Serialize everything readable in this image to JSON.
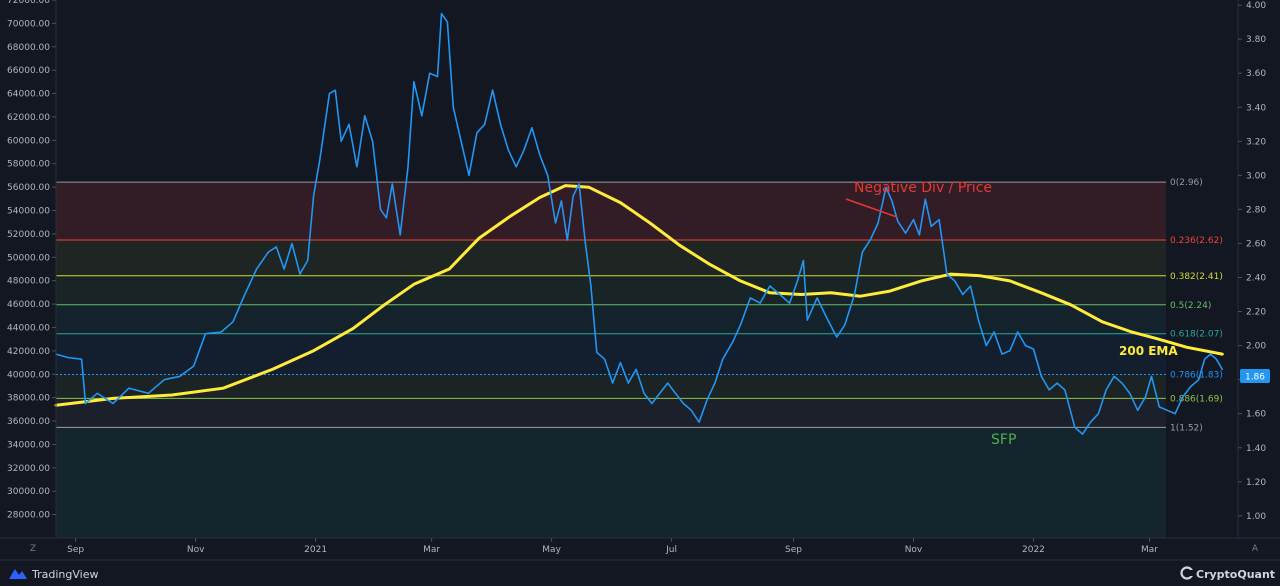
{
  "footer": {
    "left_brand": "TradingView",
    "right_brand": "CryptoQuant",
    "left_corner": "Z",
    "right_corner": "A",
    "left_logo_icon": "tradingview-logo-icon",
    "right_logo_icon": "cryptoquant-logo-icon"
  },
  "price_badge": "1.86",
  "colors": {
    "background": "#131722",
    "price_line": "#2196f3",
    "ema_line": "#ffeb3b",
    "negative_div": "#e53935",
    "sfp": "#4caf50",
    "badge": "#2196f3"
  },
  "annotations": {
    "negative_div": "Negative Div / Price",
    "sfp": "SFP",
    "ema": "200 EMA"
  },
  "chart_data": {
    "type": "line",
    "title": "",
    "x_axis": {
      "type": "time",
      "tick_labels": [
        "Sep",
        "Nov",
        "2021",
        "Mar",
        "May",
        "Jul",
        "Sep",
        "Nov",
        "2022",
        "Mar"
      ],
      "tick_dates": [
        "2020-09-01",
        "2020-11-01",
        "2021-01-01",
        "2021-03-01",
        "2021-05-01",
        "2021-07-01",
        "2021-09-01",
        "2021-11-01",
        "2022-01-01",
        "2022-03-01"
      ],
      "range": [
        "2020-08-22",
        "2022-04-15"
      ]
    },
    "y_axis_left": {
      "ticks": [
        "72000.00",
        "70000.00",
        "68000.00",
        "66000.00",
        "64000.00",
        "62000.00",
        "60000.00",
        "58000.00",
        "56000.00",
        "54000.00",
        "52000.00",
        "50000.00",
        "48000.00",
        "46000.00",
        "44000.00",
        "42000.00",
        "40000.00",
        "38000.00",
        "36000.00",
        "34000.00",
        "32000.00",
        "30000.00",
        "28000.00"
      ],
      "range": [
        26000,
        72000
      ]
    },
    "y_axis_right": {
      "ticks": [
        "4.00",
        "3.80",
        "3.60",
        "3.40",
        "3.20",
        "3.00",
        "2.80",
        "2.60",
        "2.40",
        "2.20",
        "2.00",
        "1.80",
        "1.60",
        "1.40",
        "1.20",
        "1.00"
      ],
      "range": [
        0.87,
        4.03
      ]
    },
    "fib_levels": [
      {
        "label": "0(2.96)",
        "value": 2.96,
        "color": "#9598a1"
      },
      {
        "label": "0.236(2.62)",
        "value": 2.62,
        "color": "#f44336"
      },
      {
        "label": "0.382(2.41)",
        "value": 2.41,
        "color": "#cddc39"
      },
      {
        "label": "0.5(2.24)",
        "value": 2.24,
        "color": "#66bb6a"
      },
      {
        "label": "0.618(2.07)",
        "value": 2.07,
        "color": "#26a69a"
      },
      {
        "label": "0.786(1.83)",
        "value": 1.83,
        "color": "#2196f3"
      },
      {
        "label": "0.886(1.69)",
        "value": 1.69,
        "color": "#8bc34a"
      },
      {
        "label": "1(1.52)",
        "value": 1.52,
        "color": "#9e9e9e"
      }
    ],
    "series": [
      {
        "name": "",
        "axis": "right",
        "color": "#2196f3",
        "points": [
          [
            "2020-08-22",
            1.95
          ],
          [
            "2020-08-28",
            1.93
          ],
          [
            "2020-09-04",
            1.92
          ],
          [
            "2020-09-06",
            1.66
          ],
          [
            "2020-09-12",
            1.72
          ],
          [
            "2020-09-20",
            1.66
          ],
          [
            "2020-09-28",
            1.75
          ],
          [
            "2020-10-08",
            1.72
          ],
          [
            "2020-10-16",
            1.8
          ],
          [
            "2020-10-24",
            1.82
          ],
          [
            "2020-10-31",
            1.88
          ],
          [
            "2020-11-06",
            2.07
          ],
          [
            "2020-11-14",
            2.08
          ],
          [
            "2020-11-20",
            2.14
          ],
          [
            "2020-11-26",
            2.3
          ],
          [
            "2020-12-02",
            2.45
          ],
          [
            "2020-12-08",
            2.55
          ],
          [
            "2020-12-12",
            2.58
          ],
          [
            "2020-12-16",
            2.45
          ],
          [
            "2020-12-20",
            2.6
          ],
          [
            "2020-12-24",
            2.42
          ],
          [
            "2020-12-28",
            2.5
          ],
          [
            "2020-12-31",
            2.88
          ],
          [
            "2021-01-03",
            3.08
          ],
          [
            "2021-01-08",
            3.48
          ],
          [
            "2021-01-11",
            3.5
          ],
          [
            "2021-01-14",
            3.2
          ],
          [
            "2021-01-18",
            3.3
          ],
          [
            "2021-01-22",
            3.05
          ],
          [
            "2021-01-26",
            3.35
          ],
          [
            "2021-01-30",
            3.2
          ],
          [
            "2021-02-03",
            2.8
          ],
          [
            "2021-02-06",
            2.75
          ],
          [
            "2021-02-09",
            2.95
          ],
          [
            "2021-02-13",
            2.65
          ],
          [
            "2021-02-17",
            3.05
          ],
          [
            "2021-02-20",
            3.55
          ],
          [
            "2021-02-24",
            3.35
          ],
          [
            "2021-02-28",
            3.6
          ],
          [
            "2021-03-04",
            3.58
          ],
          [
            "2021-03-06",
            3.95
          ],
          [
            "2021-03-09",
            3.9
          ],
          [
            "2021-03-12",
            3.4
          ],
          [
            "2021-03-16",
            3.2
          ],
          [
            "2021-03-20",
            3.0
          ],
          [
            "2021-03-24",
            3.25
          ],
          [
            "2021-03-28",
            3.3
          ],
          [
            "2021-04-01",
            3.5
          ],
          [
            "2021-04-05",
            3.3
          ],
          [
            "2021-04-09",
            3.15
          ],
          [
            "2021-04-13",
            3.05
          ],
          [
            "2021-04-17",
            3.15
          ],
          [
            "2021-04-21",
            3.28
          ],
          [
            "2021-04-25",
            3.12
          ],
          [
            "2021-04-29",
            3.0
          ],
          [
            "2021-05-03",
            2.72
          ],
          [
            "2021-05-06",
            2.85
          ],
          [
            "2021-05-09",
            2.62
          ],
          [
            "2021-05-12",
            2.88
          ],
          [
            "2021-05-15",
            2.95
          ],
          [
            "2021-05-18",
            2.62
          ],
          [
            "2021-05-21",
            2.35
          ],
          [
            "2021-05-24",
            1.96
          ],
          [
            "2021-05-28",
            1.92
          ],
          [
            "2021-06-01",
            1.78
          ],
          [
            "2021-06-05",
            1.9
          ],
          [
            "2021-06-09",
            1.78
          ],
          [
            "2021-06-13",
            1.86
          ],
          [
            "2021-06-17",
            1.72
          ],
          [
            "2021-06-21",
            1.66
          ],
          [
            "2021-06-25",
            1.72
          ],
          [
            "2021-06-29",
            1.78
          ],
          [
            "2021-07-03",
            1.72
          ],
          [
            "2021-07-07",
            1.66
          ],
          [
            "2021-07-11",
            1.62
          ],
          [
            "2021-07-15",
            1.55
          ],
          [
            "2021-07-19",
            1.68
          ],
          [
            "2021-07-23",
            1.78
          ],
          [
            "2021-07-27",
            1.92
          ],
          [
            "2021-08-01",
            2.02
          ],
          [
            "2021-08-05",
            2.12
          ],
          [
            "2021-08-10",
            2.28
          ],
          [
            "2021-08-15",
            2.25
          ],
          [
            "2021-08-20",
            2.35
          ],
          [
            "2021-08-25",
            2.3
          ],
          [
            "2021-08-30",
            2.25
          ],
          [
            "2021-09-03",
            2.38
          ],
          [
            "2021-09-06",
            2.5
          ],
          [
            "2021-09-08",
            2.15
          ],
          [
            "2021-09-13",
            2.28
          ],
          [
            "2021-09-18",
            2.16
          ],
          [
            "2021-09-23",
            2.05
          ],
          [
            "2021-09-27",
            2.12
          ],
          [
            "2021-10-02",
            2.3
          ],
          [
            "2021-10-06",
            2.55
          ],
          [
            "2021-10-10",
            2.62
          ],
          [
            "2021-10-14",
            2.72
          ],
          [
            "2021-10-18",
            2.93
          ],
          [
            "2021-10-21",
            2.85
          ],
          [
            "2021-10-24",
            2.73
          ],
          [
            "2021-10-28",
            2.66
          ],
          [
            "2021-11-01",
            2.74
          ],
          [
            "2021-11-04",
            2.65
          ],
          [
            "2021-11-07",
            2.86
          ],
          [
            "2021-11-10",
            2.7
          ],
          [
            "2021-11-14",
            2.74
          ],
          [
            "2021-11-18",
            2.42
          ],
          [
            "2021-11-22",
            2.38
          ],
          [
            "2021-11-26",
            2.3
          ],
          [
            "2021-11-30",
            2.35
          ],
          [
            "2021-12-04",
            2.15
          ],
          [
            "2021-12-08",
            2.0
          ],
          [
            "2021-12-12",
            2.08
          ],
          [
            "2021-12-16",
            1.95
          ],
          [
            "2021-12-20",
            1.97
          ],
          [
            "2021-12-24",
            2.08
          ],
          [
            "2021-12-28",
            2.0
          ],
          [
            "2022-01-01",
            1.98
          ],
          [
            "2022-01-05",
            1.82
          ],
          [
            "2022-01-09",
            1.74
          ],
          [
            "2022-01-13",
            1.78
          ],
          [
            "2022-01-17",
            1.74
          ],
          [
            "2022-01-22",
            1.52
          ],
          [
            "2022-01-26",
            1.48
          ],
          [
            "2022-01-30",
            1.55
          ],
          [
            "2022-02-03",
            1.6
          ],
          [
            "2022-02-07",
            1.74
          ],
          [
            "2022-02-11",
            1.82
          ],
          [
            "2022-02-15",
            1.78
          ],
          [
            "2022-02-19",
            1.72
          ],
          [
            "2022-02-23",
            1.62
          ],
          [
            "2022-02-27",
            1.7
          ],
          [
            "2022-03-02",
            1.82
          ],
          [
            "2022-03-06",
            1.64
          ],
          [
            "2022-03-10",
            1.62
          ],
          [
            "2022-03-14",
            1.6
          ],
          [
            "2022-03-18",
            1.7
          ],
          [
            "2022-03-22",
            1.76
          ],
          [
            "2022-03-26",
            1.8
          ],
          [
            "2022-03-29",
            1.92
          ],
          [
            "2022-04-01",
            1.95
          ],
          [
            "2022-04-04",
            1.92
          ],
          [
            "2022-04-07",
            1.86
          ]
        ]
      },
      {
        "name": "200 EMA",
        "axis": "right",
        "color": "#ffeb3b",
        "points": [
          [
            "2020-08-22",
            1.65
          ],
          [
            "2020-09-20",
            1.69
          ],
          [
            "2020-10-20",
            1.71
          ],
          [
            "2020-11-15",
            1.75
          ],
          [
            "2020-12-10",
            1.86
          ],
          [
            "2020-12-31",
            1.97
          ],
          [
            "2021-01-20",
            2.1
          ],
          [
            "2021-02-05",
            2.24
          ],
          [
            "2021-02-20",
            2.36
          ],
          [
            "2021-03-10",
            2.45
          ],
          [
            "2021-03-25",
            2.63
          ],
          [
            "2021-04-10",
            2.76
          ],
          [
            "2021-04-25",
            2.87
          ],
          [
            "2021-05-08",
            2.94
          ],
          [
            "2021-05-20",
            2.93
          ],
          [
            "2021-06-05",
            2.84
          ],
          [
            "2021-06-20",
            2.72
          ],
          [
            "2021-07-05",
            2.59
          ],
          [
            "2021-07-20",
            2.48
          ],
          [
            "2021-08-05",
            2.38
          ],
          [
            "2021-08-20",
            2.31
          ],
          [
            "2021-09-05",
            2.3
          ],
          [
            "2021-09-20",
            2.31
          ],
          [
            "2021-10-05",
            2.29
          ],
          [
            "2021-10-20",
            2.32
          ],
          [
            "2021-11-05",
            2.38
          ],
          [
            "2021-11-20",
            2.42
          ],
          [
            "2021-12-05",
            2.41
          ],
          [
            "2021-12-20",
            2.38
          ],
          [
            "2022-01-05",
            2.31
          ],
          [
            "2022-01-20",
            2.24
          ],
          [
            "2022-02-05",
            2.14
          ],
          [
            "2022-02-20",
            2.08
          ],
          [
            "2022-03-05",
            2.04
          ],
          [
            "2022-03-20",
            1.99
          ],
          [
            "2022-04-07",
            1.95
          ]
        ]
      }
    ],
    "last_value": 1.86,
    "grid": false,
    "y_scale": "linear"
  }
}
